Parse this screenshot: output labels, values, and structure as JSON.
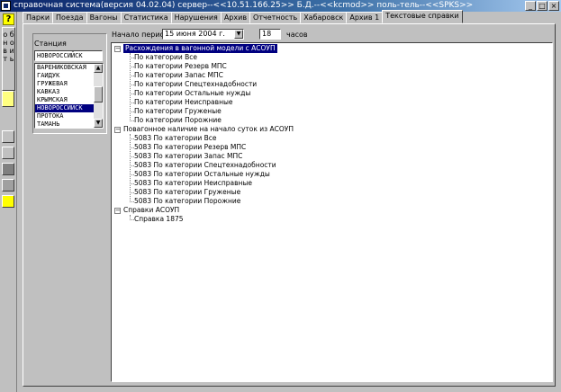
{
  "window": {
    "title": "справочная система(версия 04.02.04) сервер--<<10.51.166.25>> Б.Д.--<<kcmod>> поль-тель--<<SPKS>>",
    "buttons": {
      "minimize": "_",
      "maximize": "□",
      "close": "×"
    }
  },
  "leftbar": {
    "help_label": "?",
    "refresh_label": "о б н о в и т ь"
  },
  "tabs": [
    "Парки",
    "Поезда",
    "Вагоны",
    "Статистика",
    "Нарушения",
    "Архив",
    "Отчетность",
    "Хабаровск",
    "Архив 1",
    "Текстовые справки"
  ],
  "active_tab": "Текстовые справки",
  "station": {
    "label": "Станция",
    "value": "НОВОРОССИЙСК",
    "list": [
      "ВАРЕНИКОВСКАЯ",
      "ГАЙДУК",
      "ГРУЖЕВАЯ",
      "КАВКАЗ",
      "КРЫМСКАЯ",
      "НОВОРОССИЙСК",
      "ПРОТОКА",
      "ТАМАНЬ"
    ],
    "selected": "НОВОРОССИЙСК"
  },
  "period": {
    "label": "Начало периода",
    "date": "15    июня    2004 г.",
    "hours": "18",
    "hours_label": "часов"
  },
  "tree": {
    "groups": [
      {
        "label": "Расхождения в вагонной модели с АСОУП",
        "children": [
          "По категории Все",
          "По категории Резерв МПС",
          "По категории Запас МПС",
          "По категории Спецтехнадобности",
          "По категории Остальные нужды",
          "По категории Неисправные",
          "По категории Груженые",
          "По категории Порожние"
        ]
      },
      {
        "label": "Повагонное наличие на начало суток из АСОУП",
        "children": [
          "5083 По категории Все",
          "5083 По категории Резерв МПС",
          "5083 По категории Запас МПС",
          "5083 По категории Спецтехнадобности",
          "5083 По категории Остальные нужды",
          "5083 По категории Неисправные",
          "5083 По категории Груженые",
          "5083 По категории Порожние"
        ]
      },
      {
        "label": "Справки АСОУП",
        "children": [
          "Справка 1875"
        ]
      }
    ],
    "expander_symbol": "−"
  },
  "colors": {
    "selection": "#000080",
    "title_start": "#0a246a",
    "face": "#c0c0c0"
  }
}
